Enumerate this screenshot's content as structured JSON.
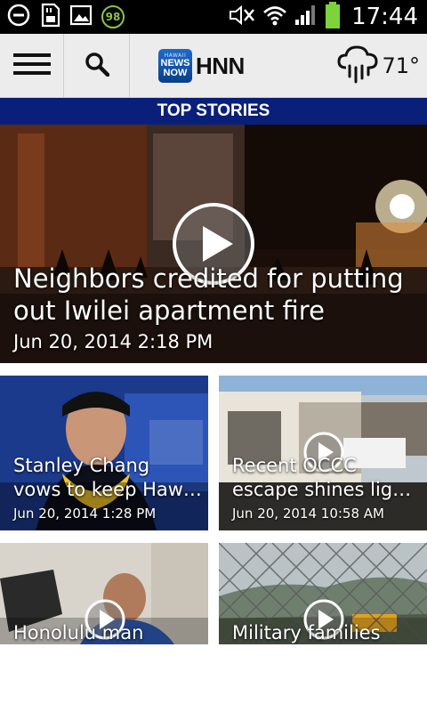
{
  "status_bar": {
    "notification_badge": "98",
    "time": "17:44",
    "icons": [
      "do-not-disturb-icon",
      "sd-card-icon",
      "image-icon",
      "battery-saver-badge-icon",
      "mute-icon",
      "wifi-icon",
      "signal-icon",
      "battery-icon"
    ]
  },
  "app_bar": {
    "menu_icon": "hamburger-menu-icon",
    "search_icon": "search-icon",
    "logo": {
      "badge_line1": "HAWAII",
      "badge_line2": "NEWS",
      "badge_line3": "NOW",
      "text": "HNN"
    },
    "weather": {
      "icon": "rain-cloud-icon",
      "temperature": "71°"
    }
  },
  "section_banner": "TOP STORIES",
  "hero_story": {
    "headline_line1": "Neighbors credited for putting",
    "headline_line2": "out Iwilei apartment fire",
    "date": "Jun 20, 2014 2:18 PM",
    "has_video": true
  },
  "stories": [
    {
      "title_line1": "Stanley Chang",
      "title_line2": "vows to keep Haw…",
      "date": "Jun 20, 2014 1:28 PM",
      "has_video": false
    },
    {
      "title_line1": "Recent OCCC",
      "title_line2": "escape shines lig…",
      "date": "Jun 20, 2014 10:58 AM",
      "has_video": true
    },
    {
      "title_line1": "Honolulu man",
      "title_line2": "",
      "date": "",
      "has_video": true
    },
    {
      "title_line1": "Military families",
      "title_line2": "",
      "date": "",
      "has_video": true
    }
  ],
  "colors": {
    "banner_bg": "#0a1f7a",
    "app_bar_bg": "#ececec",
    "status_bar_bg": "#000000",
    "battery_green": "#7cd43a"
  }
}
